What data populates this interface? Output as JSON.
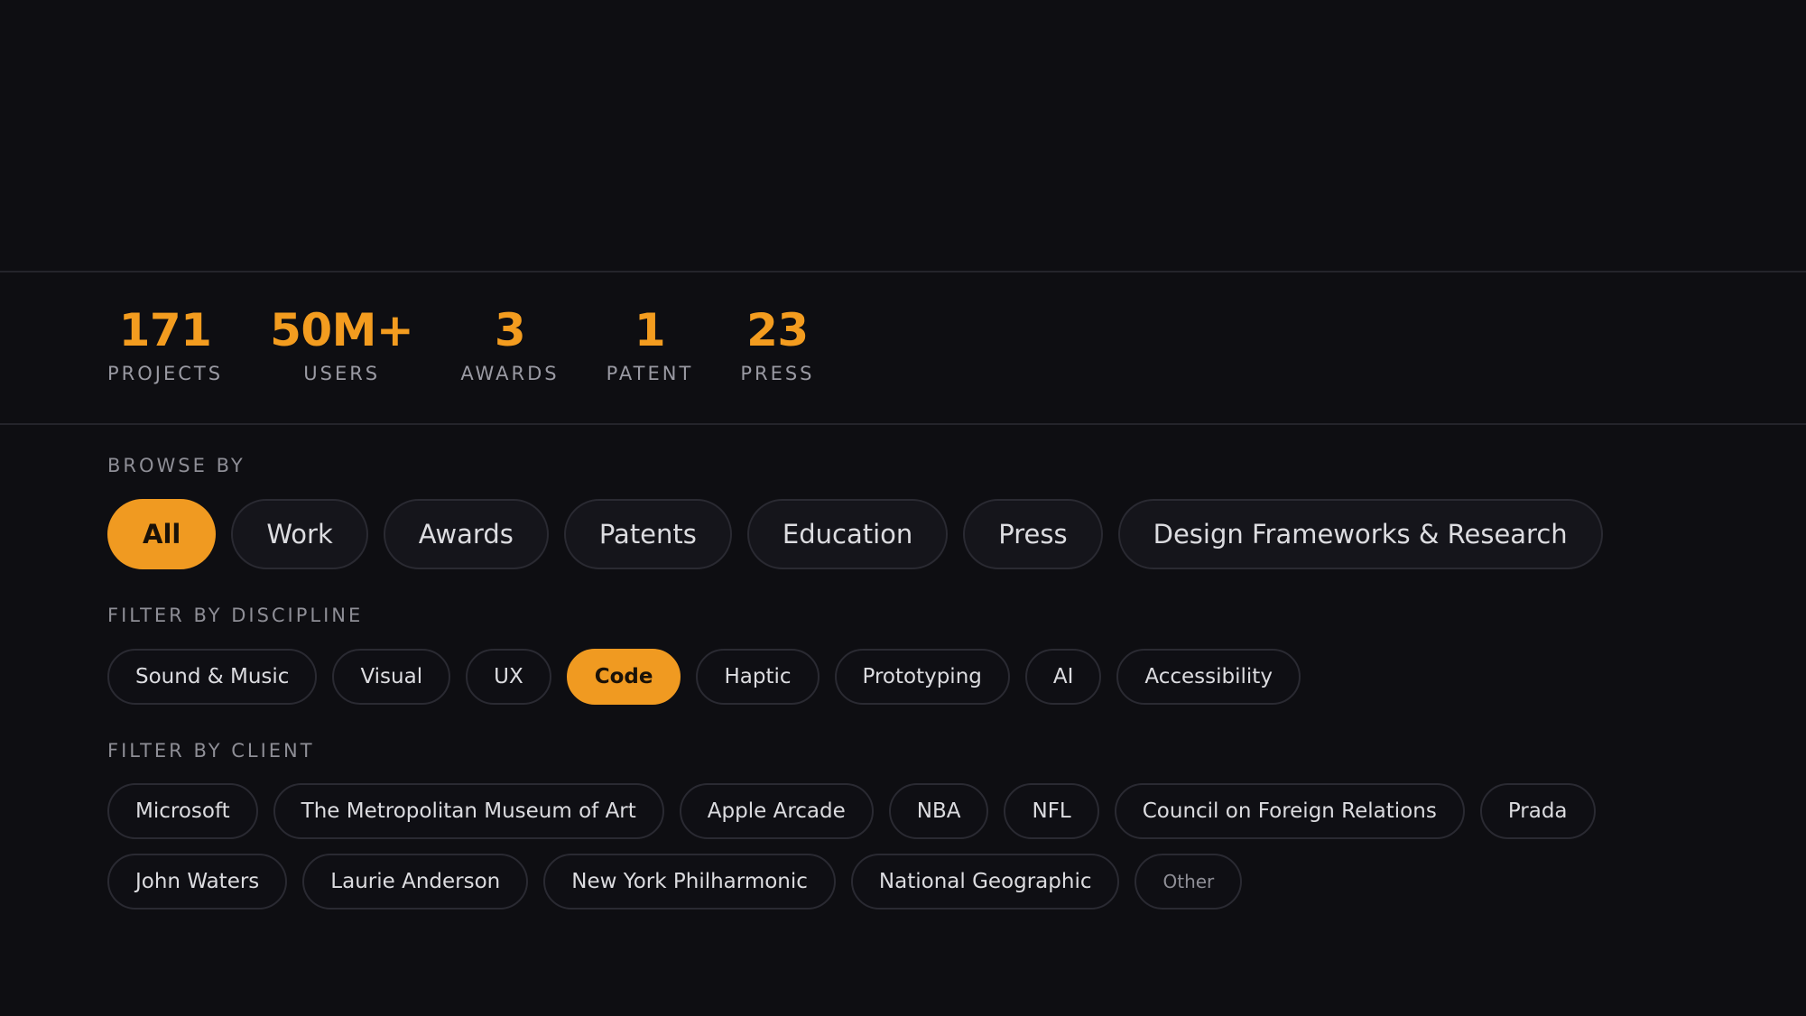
{
  "stats": [
    {
      "value": "171",
      "label": "PROJECTS"
    },
    {
      "value": "50M+",
      "label": "USERS"
    },
    {
      "value": "3",
      "label": "AWARDS"
    },
    {
      "value": "1",
      "label": "PATENT"
    },
    {
      "value": "23",
      "label": "PRESS"
    }
  ],
  "browse": {
    "label": "BROWSE BY",
    "items": [
      "All",
      "Work",
      "Awards",
      "Patents",
      "Education",
      "Press",
      "Design Frameworks & Research"
    ],
    "active": "All"
  },
  "discipline": {
    "label": "FILTER BY DISCIPLINE",
    "items": [
      "Sound & Music",
      "Visual",
      "UX",
      "Code",
      "Haptic",
      "Prototyping",
      "AI",
      "Accessibility"
    ],
    "active": "Code"
  },
  "client": {
    "label": "FILTER BY CLIENT",
    "items": [
      "Microsoft",
      "The Metropolitan Museum of Art",
      "Apple Arcade",
      "NBA",
      "NFL",
      "Council on Foreign Relations",
      "Prada",
      "John Waters",
      "Laurie Anderson",
      "New York Philharmonic",
      "National Geographic",
      "Other"
    ]
  },
  "colors": {
    "accent": "#f09a21",
    "background": "#0e0e12"
  }
}
